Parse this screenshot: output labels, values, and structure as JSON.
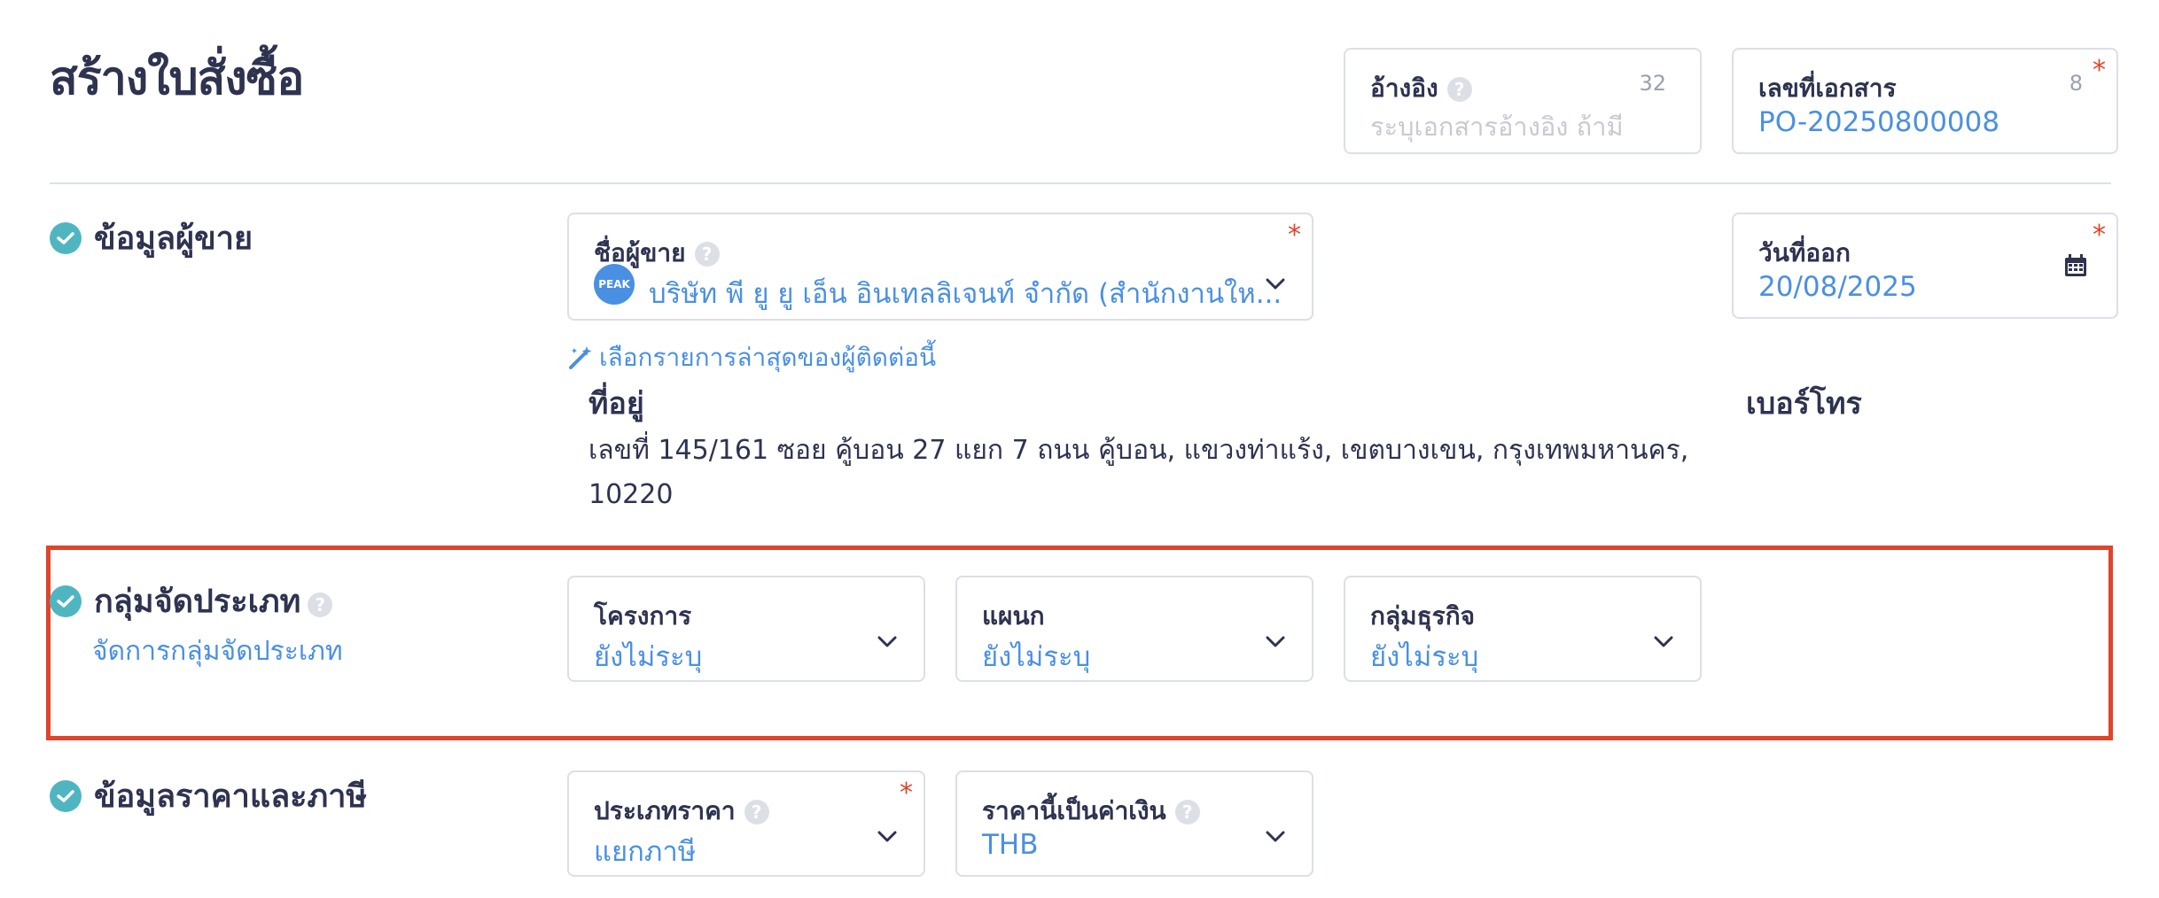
{
  "page": {
    "title": "สร้างใบสั่งซื้อ"
  },
  "reference": {
    "label": "อ้างอิง",
    "help_icon": "?",
    "counter": "32",
    "placeholder": "ระบุเอกสารอ้างอิง ถ้ามี"
  },
  "doc_number": {
    "label": "เลขที่เอกสาร",
    "counter": "8",
    "required": "*",
    "value": "PO-20250800008"
  },
  "vendor_section": {
    "title": "ข้อมูลผู้ขาย",
    "vendor_name": {
      "label": "ชื่อผู้ขาย",
      "help_icon": "?",
      "required": "*",
      "avatar_text": "PEAK",
      "value": "บริษัท พี ยู ยู เอ็น อินเทลลิเจนท์ จำกัด (สำนักงานให..."
    },
    "issue_date": {
      "label": "วันที่ออก",
      "required": "*",
      "value": "20/08/2025"
    },
    "recent_link": "เลือกรายการล่าสุดของผู้ติดต่อนี้",
    "address_label": "ที่อยู่",
    "address_value": "เลขที่ 145/161 ซอย คู้บอน 27 แยก 7 ถนน คู้บอน, แขวงท่าแร้ง, เขตบางเขน, กรุงเทพมหานคร, 10220",
    "phone_label": "เบอร์โทร"
  },
  "category_section": {
    "title": "กลุ่มจัดประเภท",
    "help_icon": "?",
    "manage_link": "จัดการกลุ่มจัดประเภท",
    "project": {
      "label": "โครงการ",
      "value": "ยังไม่ระบุ"
    },
    "department": {
      "label": "แผนก",
      "value": "ยังไม่ระบุ"
    },
    "business_group": {
      "label": "กลุ่มธุรกิจ",
      "value": "ยังไม่ระบุ"
    }
  },
  "pricing_section": {
    "title": "ข้อมูลราคาและภาษี",
    "price_type": {
      "label": "ประเภทราคา",
      "help_icon": "?",
      "required": "*",
      "value": "แยกภาษี"
    },
    "currency": {
      "label": "ราคานี้เป็นค่าเงิน",
      "help_icon": "?",
      "value": "THB"
    }
  },
  "colors": {
    "accent": "#4a90e2",
    "check": "#4fb6c1",
    "required": "#e0442a",
    "highlight": "#e0442a"
  }
}
